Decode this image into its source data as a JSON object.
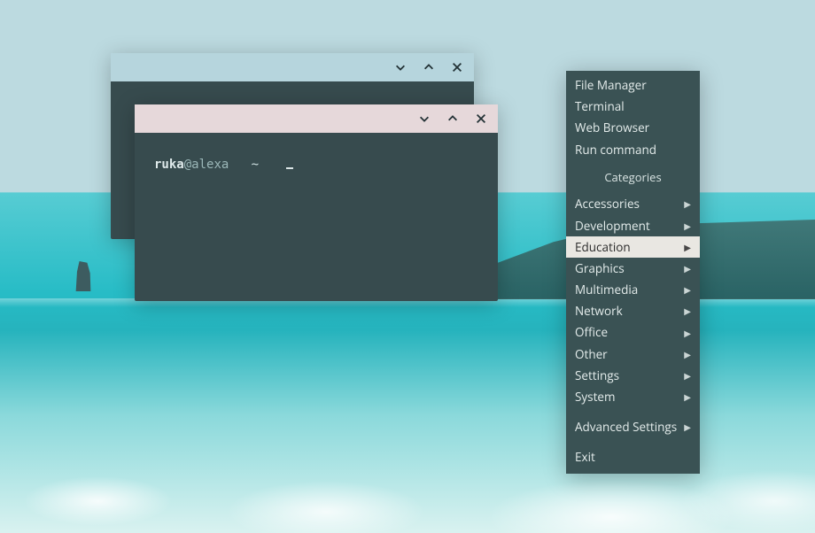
{
  "terminal": {
    "prompt_user": "ruka",
    "prompt_at": "@",
    "prompt_host": "alexa",
    "prompt_path": "~",
    "prompt_cursor": "_"
  },
  "window_controls": {
    "minimize_name": "minimize-icon",
    "maximize_name": "maximize-icon",
    "close_name": "close-icon"
  },
  "menu": {
    "top_items": [
      {
        "label": "File Manager"
      },
      {
        "label": "Terminal"
      },
      {
        "label": "Web Browser"
      },
      {
        "label": "Run command"
      }
    ],
    "categories_heading": "Categories",
    "categories": [
      {
        "label": "Accessories",
        "submenu": true,
        "highlight": false
      },
      {
        "label": "Development",
        "submenu": true,
        "highlight": false
      },
      {
        "label": "Education",
        "submenu": true,
        "highlight": true
      },
      {
        "label": "Graphics",
        "submenu": true,
        "highlight": false
      },
      {
        "label": "Multimedia",
        "submenu": true,
        "highlight": false
      },
      {
        "label": "Network",
        "submenu": true,
        "highlight": false
      },
      {
        "label": "Office",
        "submenu": true,
        "highlight": false
      },
      {
        "label": "Other",
        "submenu": true,
        "highlight": false
      },
      {
        "label": "Settings",
        "submenu": true,
        "highlight": false
      },
      {
        "label": "System",
        "submenu": true,
        "highlight": false
      }
    ],
    "advanced": {
      "label": "Advanced Settings",
      "submenu": true
    },
    "exit": {
      "label": "Exit"
    }
  },
  "colors": {
    "panel_bg": "#3a5254",
    "terminal_bg": "#374b4e",
    "titlebar_blue": "#b6d5dd",
    "titlebar_pink": "#e6d8da",
    "highlight_bg": "#e9e7e2"
  }
}
